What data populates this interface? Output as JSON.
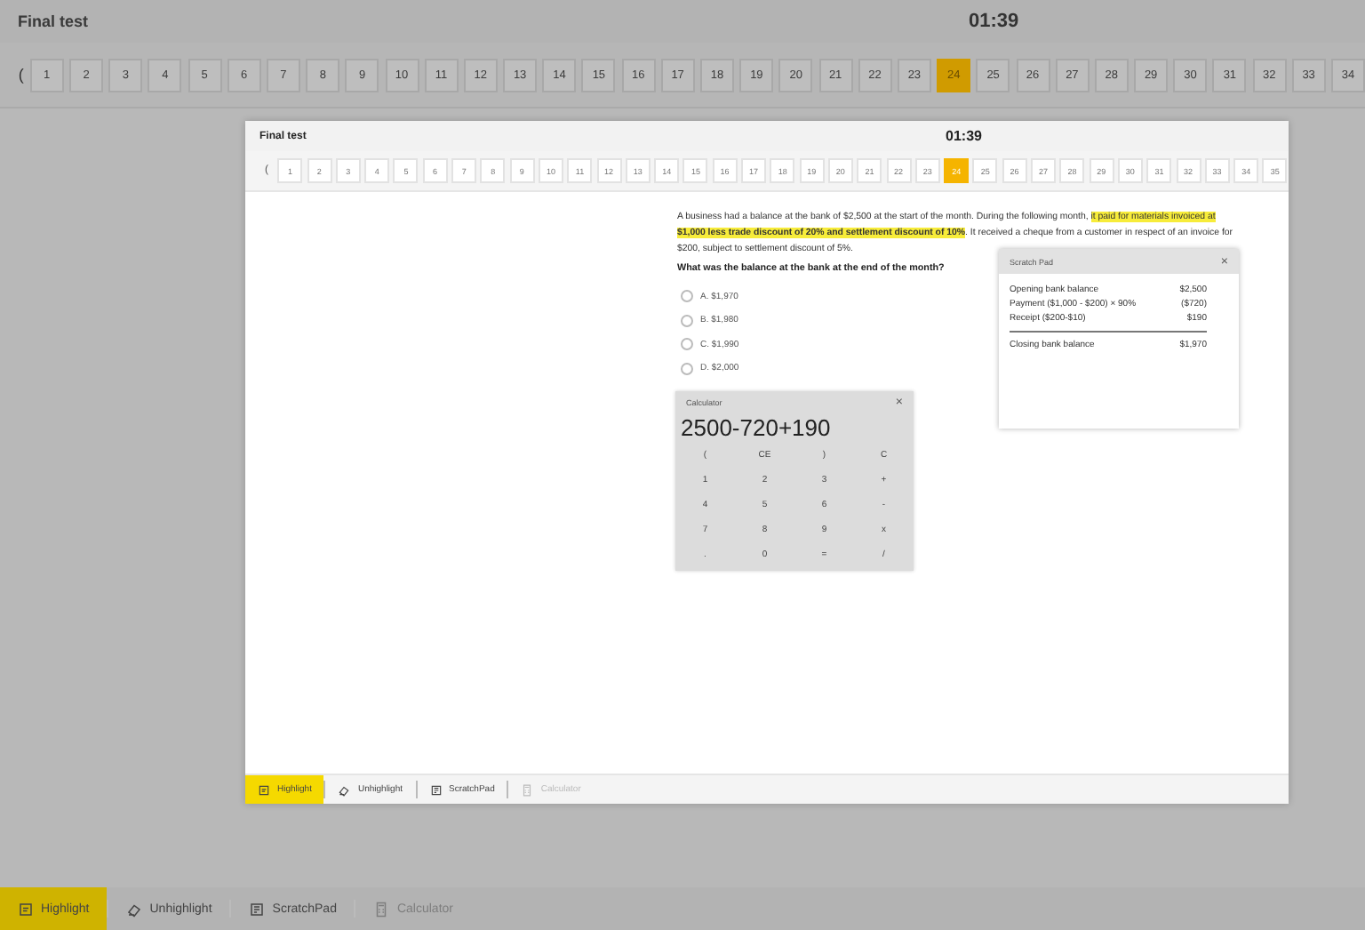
{
  "background": {
    "title": "Final test",
    "timer": "01:39",
    "prev": "(",
    "questions": [
      {
        "label": "1",
        "selected": false
      },
      {
        "label": "2",
        "selected": false
      },
      {
        "label": "3",
        "selected": false
      },
      {
        "label": "4",
        "selected": false
      },
      {
        "label": "5",
        "selected": false
      },
      {
        "label": "6",
        "selected": false
      },
      {
        "label": "7",
        "selected": false
      },
      {
        "label": "8",
        "selected": false
      },
      {
        "label": "9",
        "selected": false
      },
      {
        "label": "10",
        "selected": false
      },
      {
        "label": "11",
        "selected": false
      },
      {
        "label": "12",
        "selected": false
      },
      {
        "label": "13",
        "selected": false
      },
      {
        "label": "14",
        "selected": false
      },
      {
        "label": "15",
        "selected": false
      },
      {
        "label": "16",
        "selected": false
      },
      {
        "label": "17",
        "selected": false
      },
      {
        "label": "18",
        "selected": false
      },
      {
        "label": "19",
        "selected": false
      },
      {
        "label": "20",
        "selected": false
      },
      {
        "label": "21",
        "selected": false
      },
      {
        "label": "22",
        "selected": false
      },
      {
        "label": "23",
        "selected": false
      },
      {
        "label": "24",
        "selected": true
      },
      {
        "label": "25",
        "selected": false
      },
      {
        "label": "26",
        "selected": false
      },
      {
        "label": "27",
        "selected": false
      },
      {
        "label": "28",
        "selected": false
      },
      {
        "label": "29",
        "selected": false
      },
      {
        "label": "30",
        "selected": false
      },
      {
        "label": "31",
        "selected": false
      },
      {
        "label": "32",
        "selected": false
      },
      {
        "label": "33",
        "selected": false
      },
      {
        "label": "34",
        "selected": false
      }
    ],
    "tools": [
      {
        "kind": "highlight",
        "label": "Highlight",
        "selected": true,
        "disabled": false
      },
      {
        "kind": "unhighlight",
        "label": "Unhighlight",
        "selected": false,
        "disabled": false
      },
      {
        "kind": "scratchpad",
        "label": "ScratchPad",
        "selected": false,
        "disabled": false
      },
      {
        "kind": "calculator",
        "label": "Calculator",
        "selected": false,
        "disabled": true
      }
    ]
  },
  "window": {
    "title": "Final test",
    "timer": "01:39",
    "prev": "(",
    "questions": [
      {
        "label": "1",
        "selected": false
      },
      {
        "label": "2",
        "selected": false
      },
      {
        "label": "3",
        "selected": false
      },
      {
        "label": "4",
        "selected": false
      },
      {
        "label": "5",
        "selected": false
      },
      {
        "label": "6",
        "selected": false
      },
      {
        "label": "7",
        "selected": false
      },
      {
        "label": "8",
        "selected": false
      },
      {
        "label": "9",
        "selected": false
      },
      {
        "label": "10",
        "selected": false
      },
      {
        "label": "11",
        "selected": false
      },
      {
        "label": "12",
        "selected": false
      },
      {
        "label": "13",
        "selected": false
      },
      {
        "label": "14",
        "selected": false
      },
      {
        "label": "15",
        "selected": false
      },
      {
        "label": "16",
        "selected": false
      },
      {
        "label": "17",
        "selected": false
      },
      {
        "label": "18",
        "selected": false
      },
      {
        "label": "19",
        "selected": false
      },
      {
        "label": "20",
        "selected": false
      },
      {
        "label": "21",
        "selected": false
      },
      {
        "label": "22",
        "selected": false
      },
      {
        "label": "23",
        "selected": false
      },
      {
        "label": "24",
        "selected": true
      },
      {
        "label": "25",
        "selected": false
      },
      {
        "label": "26",
        "selected": false
      },
      {
        "label": "27",
        "selected": false
      },
      {
        "label": "28",
        "selected": false
      },
      {
        "label": "29",
        "selected": false
      },
      {
        "label": "30",
        "selected": false
      },
      {
        "label": "31",
        "selected": false
      },
      {
        "label": "32",
        "selected": false
      },
      {
        "label": "33",
        "selected": false
      },
      {
        "label": "34",
        "selected": false
      },
      {
        "label": "35",
        "selected": false
      }
    ],
    "question": {
      "segments": [
        {
          "text": "A business had a balance at the bank of $2,500 at the start of the month. During the following month, ",
          "highlighted": false
        },
        {
          "text": "it paid for materials invoiced at **$1,000 less trade discount of 20% and settlement discount of 10%**",
          "highlighted": true
        },
        {
          "text": ". It received a cheque from a customer in respect of an invoice for $200, subject to settlement discount of 5%.",
          "highlighted": false
        }
      ],
      "prompt": "What was the balance at the bank at the end of the month?",
      "options": [
        {
          "label": "A. $1,970",
          "selected": false
        },
        {
          "label": "B. $1,980",
          "selected": false
        },
        {
          "label": "C. $1,990",
          "selected": false
        },
        {
          "label": "D. $2,000",
          "selected": false
        }
      ]
    },
    "scratch_pad": {
      "title": "Scratch Pad",
      "close": "×",
      "rows": [
        {
          "kind": "line",
          "label": "Opening bank balance",
          "value": "$2,500"
        },
        {
          "kind": "line",
          "label": "Payment ($1,000 - $200) × 90%",
          "value": "($720)"
        },
        {
          "kind": "line",
          "label": "Receipt ($200-$10)",
          "value": "$190"
        },
        {
          "kind": "rule"
        },
        {
          "kind": "line",
          "label": "Closing bank balance",
          "value": "$1,970"
        }
      ]
    },
    "calculator": {
      "title": "Calculator",
      "close": "×",
      "display": "2500-720+190",
      "keys": [
        "(",
        "CE",
        ")",
        "C",
        "1",
        "2",
        "3",
        "+",
        "4",
        "5",
        "6",
        "-",
        "7",
        "8",
        "9",
        "x",
        ".",
        "0",
        "=",
        "/"
      ]
    },
    "tools": [
      {
        "kind": "highlight",
        "label": "Highlight",
        "selected": true,
        "disabled": false
      },
      {
        "kind": "unhighlight",
        "label": "Unhighlight",
        "selected": false,
        "disabled": false
      },
      {
        "kind": "scratchpad",
        "label": "ScratchPad",
        "selected": false,
        "disabled": false
      },
      {
        "kind": "calculator",
        "label": "Calculator",
        "selected": false,
        "disabled": true
      }
    ]
  }
}
